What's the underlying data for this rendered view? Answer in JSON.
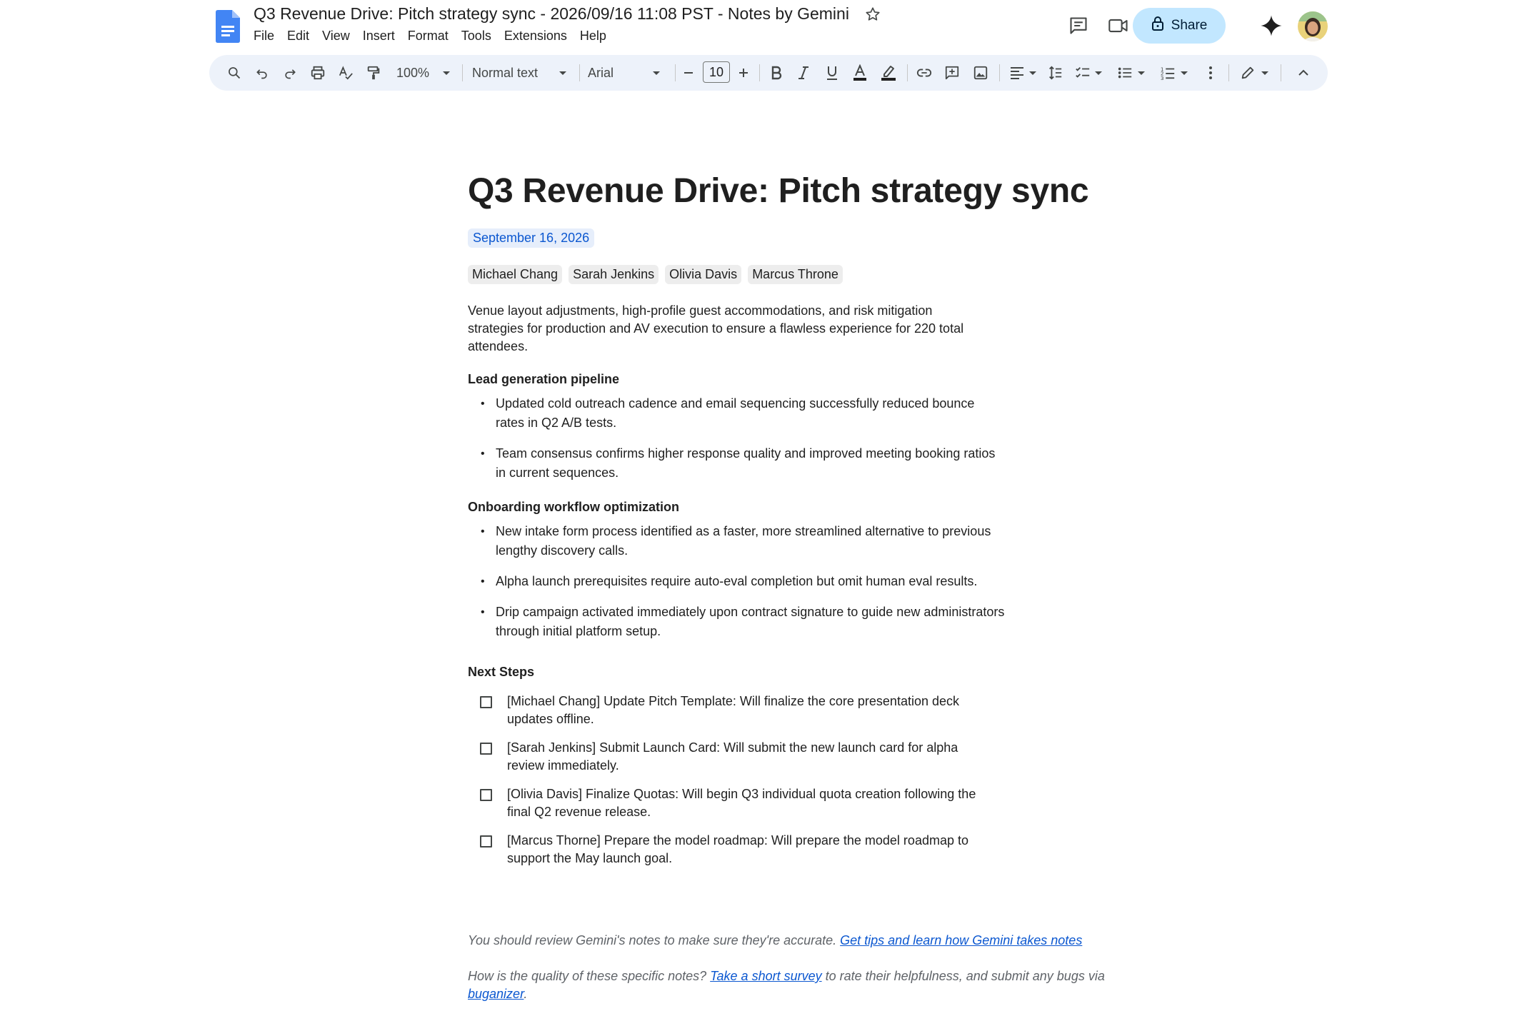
{
  "header": {
    "doc_title": "Q3 Revenue Drive: Pitch strategy sync - 2026/09/16 11:08 PST - Notes by Gemini",
    "menu": [
      "File",
      "Edit",
      "View",
      "Insert",
      "Format",
      "Tools",
      "Extensions",
      "Help"
    ],
    "share_label": "Share"
  },
  "toolbar": {
    "zoom": "100%",
    "style": "Normal text",
    "font": "Arial",
    "font_size": "10"
  },
  "doc": {
    "title": "Q3 Revenue Drive: Pitch strategy sync",
    "date": "September 16, 2026",
    "attendees": [
      "Michael Chang",
      "Sarah Jenkins",
      "Olivia Davis",
      "Marcus Throne"
    ],
    "summary": "Venue layout adjustments, high-profile guest accommodations, and risk mitigation strategies for production and AV execution to ensure a flawless experience for 220 total attendees.",
    "sections": [
      {
        "heading": "Lead generation pipeline",
        "bullets": [
          "Updated cold outreach cadence and email sequencing successfully reduced bounce rates in Q2 A/B tests.",
          "Team consensus confirms higher response quality and improved meeting booking ratios in current sequences."
        ]
      },
      {
        "heading": "Onboarding workflow optimization",
        "bullets": [
          "New intake form process identified as a faster, more streamlined alternative to previous lengthy discovery calls.",
          "Alpha launch prerequisites require auto-eval completion but omit human eval results.",
          "Drip campaign activated immediately upon contract signature to guide new administrators through initial platform setup."
        ]
      }
    ],
    "next_steps_heading": "Next Steps",
    "next_steps": [
      "[Michael Chang] Update Pitch Template: Will finalize the core presentation deck updates offline.",
      "[Sarah Jenkins] Submit Launch Card: Will submit the new launch card for alpha review immediately.",
      "[Olivia Davis] Finalize Quotas: Will begin Q3 individual quota creation following the final Q2 revenue release.",
      "[Marcus Thorne] Prepare the model roadmap:  Will prepare the model roadmap to support the May launch goal."
    ],
    "footer": {
      "review_text": "You should review Gemini's notes to make sure they're accurate. ",
      "tips_link": "Get tips and learn how Gemini takes notes",
      "quality_text": "How is the quality of these specific notes? ",
      "survey_link": "Take a short survey",
      "survey_after": " to rate their helpfulness, and submit any bugs via ",
      "bug_link": "buganizer",
      "bug_after": "."
    }
  },
  "colors": {
    "toolbar_bg": "#edf2fa",
    "share_bg": "#c2e7ff",
    "link": "#0b57d0",
    "date_chip_bg": "#e6eefb",
    "person_chip_bg": "#ededed"
  },
  "icons": [
    "docs-logo-icon",
    "star-icon",
    "comment-icon",
    "meet-icon",
    "lock-icon",
    "gemini-spark-icon",
    "search-icon",
    "undo-icon",
    "redo-icon",
    "print-icon",
    "spellcheck-icon",
    "paint-format-icon",
    "bold-icon",
    "italic-icon",
    "underline-icon",
    "text-color-icon",
    "highlight-icon",
    "link-icon",
    "add-comment-icon",
    "image-icon",
    "align-icon",
    "line-spacing-icon",
    "checklist-icon",
    "bullet-list-icon",
    "numbered-list-icon",
    "more-icon",
    "editing-mode-icon",
    "collapse-icon"
  ]
}
